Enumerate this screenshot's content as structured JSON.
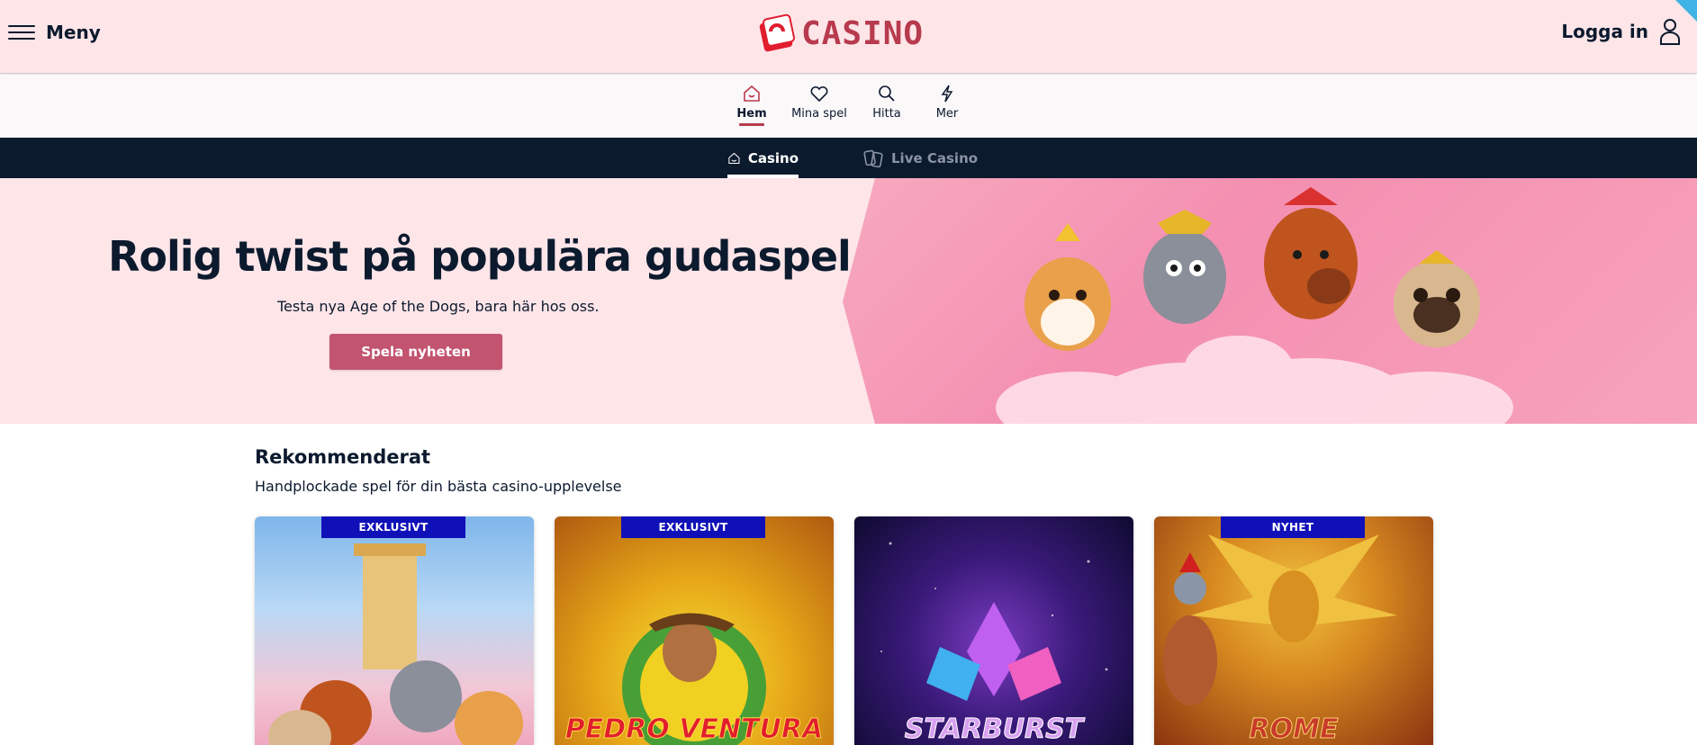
{
  "header": {
    "menu_label": "Meny",
    "logo_text": "CASINO",
    "login_label": "Logga in"
  },
  "subnav": {
    "items": [
      {
        "label": "Hem",
        "icon": "home-icon",
        "active": true
      },
      {
        "label": "Mina spel",
        "icon": "heart-icon",
        "active": false
      },
      {
        "label": "Hitta",
        "icon": "search-icon",
        "active": false
      },
      {
        "label": "Mer",
        "icon": "lightning-icon",
        "active": false
      }
    ]
  },
  "tabs": [
    {
      "label": "Casino",
      "icon": "casino-home-icon",
      "active": true
    },
    {
      "label": "Live Casino",
      "icon": "live-casino-icon",
      "active": false
    }
  ],
  "hero": {
    "title": "Rolig twist på populära gudaspel",
    "subtitle": "Testa nya Age of the Dogs, bara här hos oss.",
    "button_label": "Spela nyheten"
  },
  "recommended": {
    "title": "Rekommenderat",
    "subtitle": "Handplockade spel för din bästa casino-upplevelse",
    "cards": [
      {
        "badge": "EXKLUSIVT",
        "game_title": ""
      },
      {
        "badge": "EXKLUSIVT",
        "game_title": "PEDRO VENTURA"
      },
      {
        "badge": "",
        "game_title": "STARBURST"
      },
      {
        "badge": "NYHET",
        "game_title": "ROME"
      }
    ]
  },
  "colors": {
    "brand": "#b83a4d",
    "header_bg": "#fde5e8",
    "navy": "#0c1a2e",
    "cta": "#c25470",
    "badge": "#1010b8"
  }
}
